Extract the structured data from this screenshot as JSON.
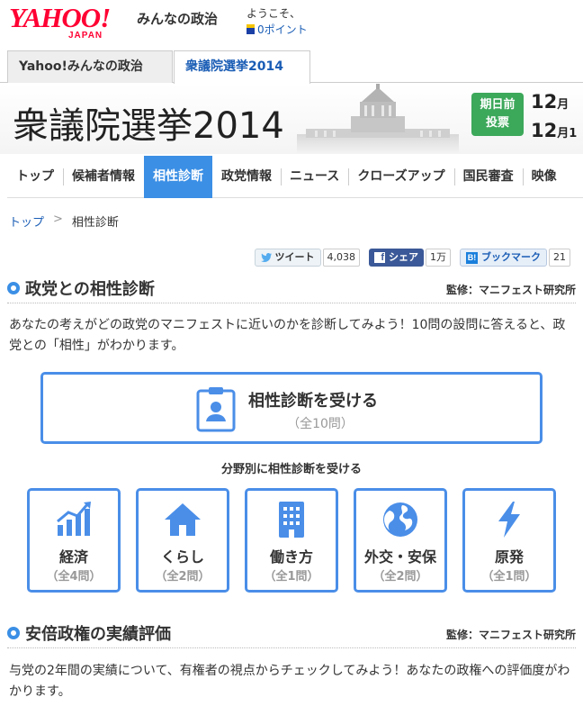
{
  "header": {
    "logo_text": "YAHOO!",
    "logo_sub": "JAPAN",
    "service_name": "みんなの政治",
    "welcome": "ようこそ、",
    "points": "0ポイント"
  },
  "tabs": [
    {
      "label": "Yahoo!みんなの政治"
    },
    {
      "label": "衆議院選挙2014"
    }
  ],
  "banner": {
    "title": "衆議院選挙",
    "year": "2014",
    "vote_label_1": "期日前",
    "vote_label_2": "投票",
    "date_1_month": "12",
    "date_1_unit": "月",
    "date_2_month": "12",
    "date_2_unit": "月1"
  },
  "nav": [
    {
      "label": "トップ"
    },
    {
      "label": "候補者情報"
    },
    {
      "label": "相性診断"
    },
    {
      "label": "政党情報"
    },
    {
      "label": "ニュース"
    },
    {
      "label": "クローズアップ"
    },
    {
      "label": "国民審査"
    },
    {
      "label": "映像"
    }
  ],
  "breadcrumb": {
    "home": "トップ",
    "sep": ">",
    "current": "相性診断"
  },
  "social": {
    "tweet_label": "ツイート",
    "tweet_count": "4,038",
    "share_label": "シェア",
    "share_count": "1万",
    "bookmark_label": "ブックマーク",
    "bookmark_count": "21"
  },
  "section1": {
    "title": "政党との相性診断",
    "supervisor": "監修：マニフェスト研究所",
    "description": "あなたの考えがどの政党のマニフェストに近いのかを診断してみよう！10問の設問に答えると、政党との「相性」がわかります。",
    "main_button_label": "相性診断を受ける",
    "main_button_sub": "（全10問）",
    "by_field_label": "分野別に相性診断を受ける"
  },
  "categories": [
    {
      "name": "経済",
      "count": "（全4問）",
      "icon": "chart-icon"
    },
    {
      "name": "くらし",
      "count": "（全2問）",
      "icon": "house-icon"
    },
    {
      "name": "働き方",
      "count": "（全1問）",
      "icon": "building-icon"
    },
    {
      "name": "外交・安保",
      "count": "（全2問）",
      "icon": "globe-icon"
    },
    {
      "name": "原発",
      "count": "（全1問）",
      "icon": "lightning-icon"
    }
  ],
  "section2": {
    "title": "安倍政権の実績評価",
    "supervisor": "監修：マニフェスト研究所",
    "description": "与党の2年間の実績について、有権者の視点からチェックしてみよう！あなたの政権への評価度がわかります。"
  },
  "colors": {
    "accent": "#3b8fe5",
    "link": "#1a5db5",
    "yahoo_red": "#ff0033",
    "vote_green": "#3ca85a"
  }
}
